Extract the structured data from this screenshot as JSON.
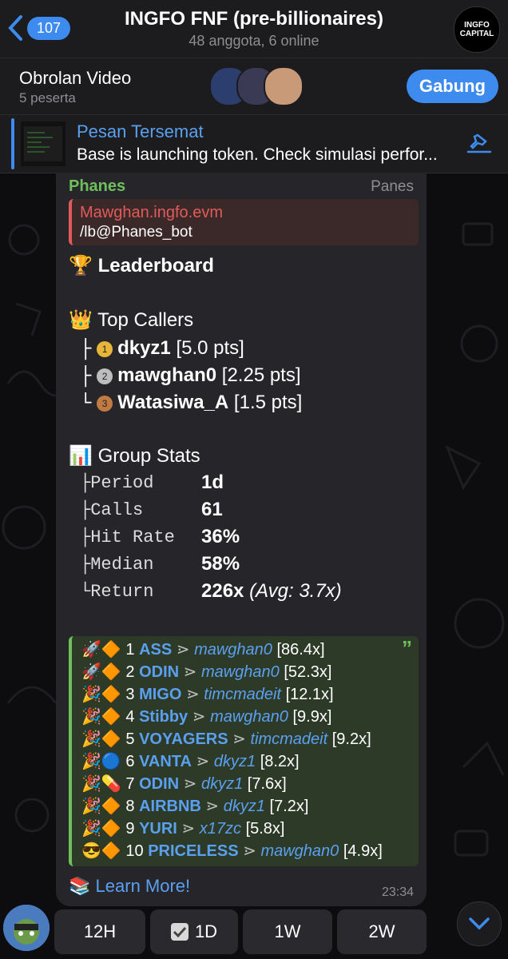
{
  "header": {
    "back_count": "107",
    "title": "INGFO FNF (pre-billionaires)",
    "subtitle": "48 anggota, 6 online",
    "logo_line1": "INGFO",
    "logo_line2": "CAPITAL"
  },
  "video": {
    "title": "Obrolan Video",
    "participants": "5 peserta",
    "join_label": "Gabung"
  },
  "pinned": {
    "title": "Pesan Tersemat",
    "text": "Base is launching token. Check simulasi perfor..."
  },
  "message": {
    "sender": "Phanes",
    "sender_tag": "Panes",
    "reply_name": "Mawghan.ingfo.evm",
    "reply_text": "/lb@Phanes_bot",
    "leaderboard_title": "Leaderboard",
    "top_callers_title": "Top Callers",
    "callers": [
      {
        "name": "dkyz1",
        "pts": "[5.0 pts]",
        "rank": "1"
      },
      {
        "name": "mawghan0",
        "pts": "[2.25 pts]",
        "rank": "2"
      },
      {
        "name": "Watasiwa_A",
        "pts": "[1.5 pts]",
        "rank": "3"
      }
    ],
    "group_stats_title": "Group Stats",
    "stats": [
      {
        "label": "Period",
        "value": "1d"
      },
      {
        "label": "Calls",
        "value": "61"
      },
      {
        "label": "Hit Rate",
        "value": "36%"
      },
      {
        "label": "Median",
        "value": "58%"
      },
      {
        "label": "Return",
        "value": "226x",
        "extra": "(Avg: 3.7x)"
      }
    ],
    "calls": [
      {
        "n": "1",
        "token": "ASS",
        "user": "mawghan0",
        "mult": "[86.4x]"
      },
      {
        "n": "2",
        "token": "ODIN",
        "user": "mawghan0",
        "mult": "[52.3x]"
      },
      {
        "n": "3",
        "token": "MIGO",
        "user": "timcmadeit",
        "mult": "[12.1x]"
      },
      {
        "n": "4",
        "token": "Stibby",
        "user": "mawghan0",
        "mult": "[9.9x]"
      },
      {
        "n": "5",
        "token": "VOYAGERS",
        "user": "timcmadeit",
        "mult": "[9.2x]"
      },
      {
        "n": "6",
        "token": "VANTA",
        "user": "dkyz1",
        "mult": "[8.2x]"
      },
      {
        "n": "7",
        "token": "ODIN",
        "user": "dkyz1",
        "mult": "[7.6x]"
      },
      {
        "n": "8",
        "token": "AIRBNB",
        "user": "dkyz1",
        "mult": "[7.2x]"
      },
      {
        "n": "9",
        "token": "YURI",
        "user": "x17zc",
        "mult": "[5.8x]"
      },
      {
        "n": "10",
        "token": "PRICELESS",
        "user": "mawghan0",
        "mult": "[4.9x]"
      }
    ],
    "learn_more": "Learn More!",
    "time": "23:34"
  },
  "keyboard": {
    "buttons": [
      "12H",
      "1D",
      "1W",
      "2W"
    ],
    "selected": "1D"
  },
  "colors": {
    "accent": "#3e8bef",
    "sender": "#6fbf5d",
    "reply": "#e25b5b"
  }
}
